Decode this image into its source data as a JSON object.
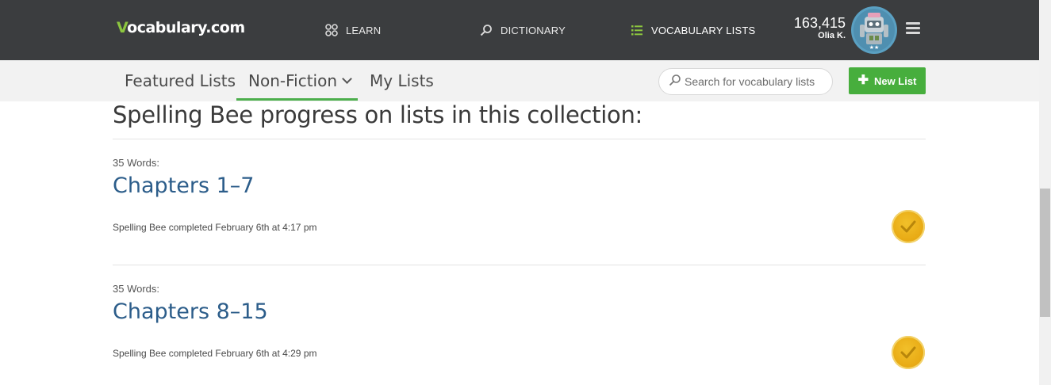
{
  "header": {
    "logo_mark": "V",
    "logo_text": "ocabulary.com",
    "nav": [
      {
        "label": "LEARN",
        "icon": "grid-icon"
      },
      {
        "label": "DICTIONARY",
        "icon": "search-icon"
      },
      {
        "label": "VOCABULARY LISTS",
        "icon": "list-icon"
      }
    ],
    "points": "163,415",
    "user_name": "Olia K.",
    "avatar_stars": "★★"
  },
  "subnav": {
    "tabs": [
      {
        "label": "Featured Lists"
      },
      {
        "label": "Non-Fiction"
      },
      {
        "label": "My Lists"
      }
    ],
    "search_placeholder": "Search for vocabulary lists",
    "new_list_label": "New List"
  },
  "main": {
    "heading": "Spelling Bee progress on lists in this collection:",
    "lists": [
      {
        "words": "35 Words:",
        "title": "Chapters 1–7",
        "status": "Spelling Bee completed February 6th at 4:17 pm"
      },
      {
        "words": "35 Words:",
        "title": "Chapters 8–15",
        "status": "Spelling Bee completed February 6th at 4:29 pm"
      }
    ]
  },
  "colors": {
    "header_bg": "#3b3d3f",
    "accent_green": "#47ae3d",
    "link_blue": "#2c5d8a",
    "badge_gold": "#e7a812"
  }
}
